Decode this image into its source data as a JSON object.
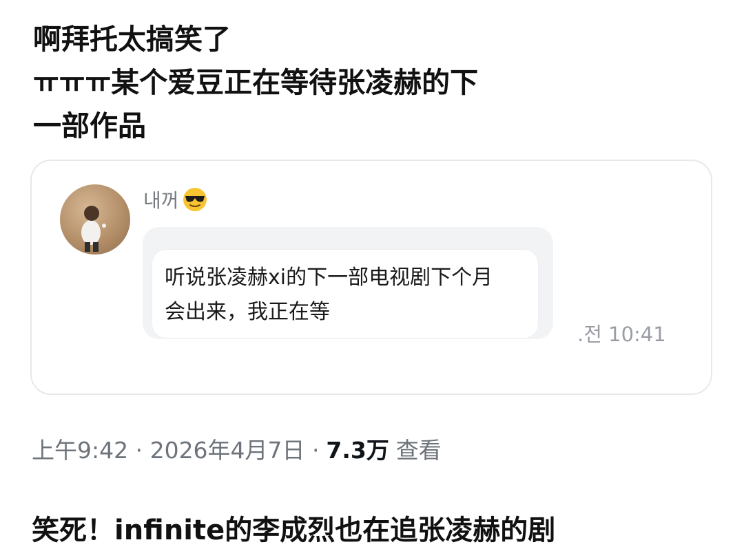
{
  "post": {
    "lines": [
      "啊拜托太搞笑了",
      "ㅠㅠㅠ某个爱豆正在等待张凌赫的下",
      "一部作品"
    ]
  },
  "quote": {
    "username": "내꺼",
    "emoji": "sunglasses-emoji",
    "message_lines": [
      "听说张凌赫xi的下一部电视剧下个月",
      "会出来，我正在等"
    ],
    "time": ".전 10:41"
  },
  "meta": {
    "time_date": "上午9:42 · 2026年4月7日 ·",
    "views_count": "7.3万",
    "views_label": "查看"
  },
  "caption": "笑死！infinite的李成烈也在追张凌赫的剧",
  "colors": {
    "text": "#111111",
    "muted": "#6c737a",
    "card_border": "#e6e8eb",
    "bubble_bg": "#f2f3f5"
  }
}
